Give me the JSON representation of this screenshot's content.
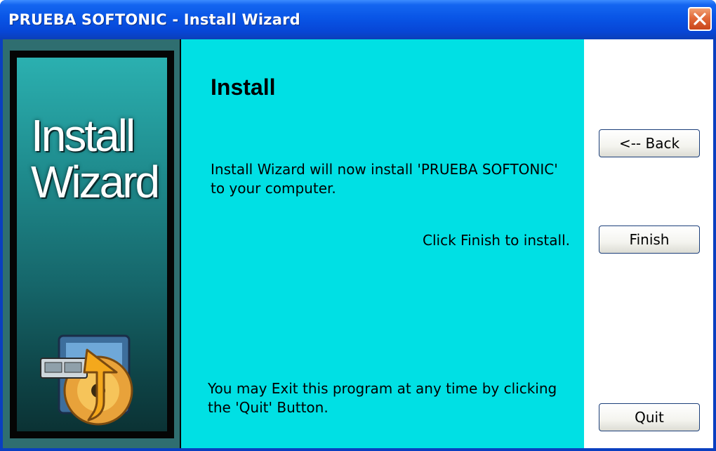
{
  "window": {
    "title": "PRUEBA SOFTONIC - Install Wizard",
    "close_icon": "close-icon"
  },
  "sidebar": {
    "banner_line1": "Install",
    "banner_line2": "Wizard",
    "art_icon": "install-disc-arrow-icon"
  },
  "main": {
    "title": "Install",
    "info": "Install Wizard will now install 'PRUEBA SOFTONIC' to your computer.",
    "click_finish": "Click Finish to install.",
    "exit_note": "You may Exit this program at any time by clicking the 'Quit' Button."
  },
  "buttons": {
    "back": "<-- Back",
    "finish": "Finish",
    "quit": "Quit"
  },
  "colors": {
    "titlebar": "#0955e6",
    "content_bg": "#00e0e4",
    "sidebar_bg": "#2f6e70",
    "close_button": "#e26a3a"
  }
}
